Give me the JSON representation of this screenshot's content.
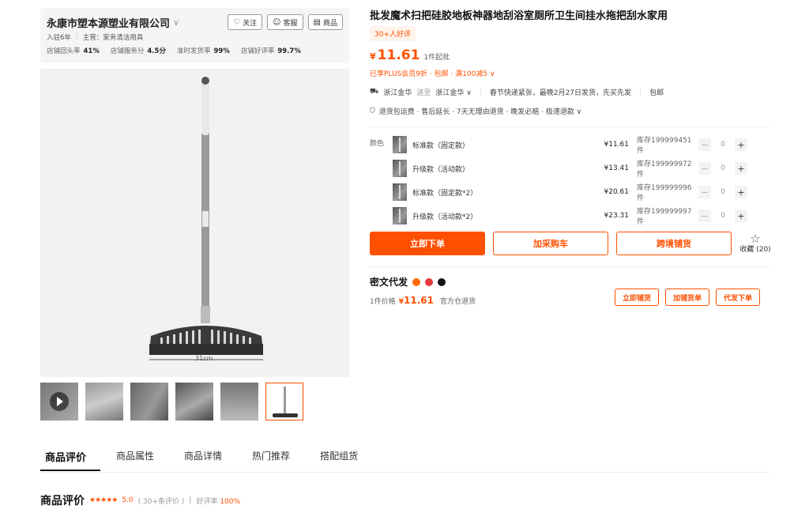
{
  "shop": {
    "name": "永康市塑本源塑业有限公司",
    "buttons": {
      "follow": "关注",
      "service": "客服",
      "goods": "商品"
    },
    "meta": {
      "years": "入驻6年",
      "main": "主营：家务清洁用具"
    },
    "stats": [
      {
        "label": "店铺回头率",
        "value": "41%"
      },
      {
        "label": "店铺服务分",
        "value": "4.5分"
      },
      {
        "label": "准时发货率",
        "value": "99%"
      },
      {
        "label": "店铺好评率",
        "value": "99.7%"
      }
    ]
  },
  "gallery": {
    "image_caption": "31cm",
    "thumbnail_count": 6,
    "active_thumbnail": 6
  },
  "tabs": [
    {
      "label": "商品评价",
      "active": true
    },
    {
      "label": "商品属性"
    },
    {
      "label": "商品详情"
    },
    {
      "label": "热门推荐"
    },
    {
      "label": "搭配组货"
    }
  ],
  "review": {
    "title": "商品评价",
    "stars": "★★★★★",
    "score": "5.0",
    "count": "( 30+条评价 )",
    "sep": "|",
    "good_label": "好评率",
    "good_rate": "100%"
  },
  "product": {
    "title": "批发魔术扫把硅胶地板神器地刮浴室厕所卫生间挂水拖把刮水家用",
    "good_badge": "30+人好评",
    "price_symbol": "¥",
    "price": "11.61",
    "moq": "1件起批",
    "promo": "已享PLUS会员9折 · 包邮 · 满100减5 ∨",
    "shipping": {
      "from": "浙江金华",
      "to_word": "送至",
      "to": "浙江金华 ∨",
      "notice": "春节快递紧张，最晚2月27日发货，先买先发",
      "free": "包邮"
    },
    "services": "退货包运费 · 售后延长 · 7天无理由退货 · 晚发必赔 · 极速退款 ∨",
    "color_label": "颜色",
    "variants": [
      {
        "name": "标准款（固定款）",
        "price": "¥11.61",
        "stock": "库存199999451件",
        "qty": "0"
      },
      {
        "name": "升级款（活动款）",
        "price": "¥13.41",
        "stock": "库存199999972件",
        "qty": "0"
      },
      {
        "name": "标准款（固定款*2）",
        "price": "¥20.61",
        "stock": "库存199999996件",
        "qty": "0"
      },
      {
        "name": "升级款（活动款*2）",
        "price": "¥23.31",
        "stock": "库存199999997件",
        "qty": "0"
      }
    ],
    "actions": {
      "buy": "立即下单",
      "cart": "加采购车",
      "cross": "跨境铺货"
    },
    "fav": {
      "label": "收藏",
      "count": "(20)"
    }
  },
  "dropship": {
    "title": "密文代发",
    "price_label": "1件价格",
    "price_symbol": "¥",
    "price": "11.61",
    "warehouse": "官方仓退货",
    "buttons": {
      "list": "立即铺货",
      "add": "加铺货单",
      "order": "代发下单"
    }
  }
}
